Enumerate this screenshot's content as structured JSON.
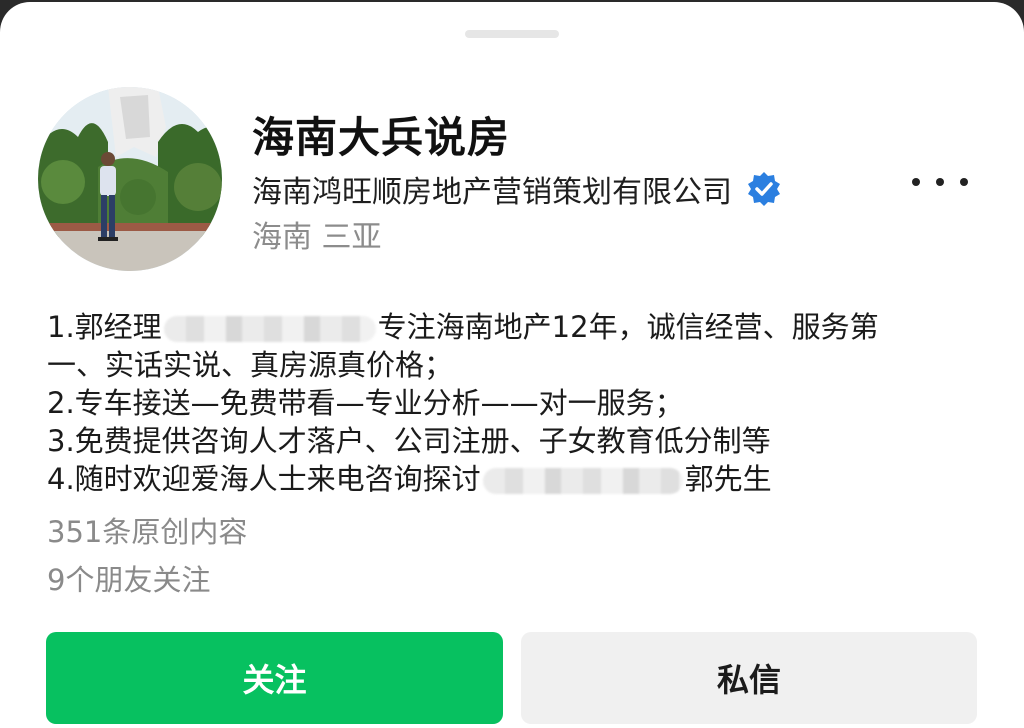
{
  "profile": {
    "name": "海南大兵说房",
    "company": "海南鸿旺顺房地产营销策划有限公司",
    "location": "海南 三亚"
  },
  "bio": {
    "line1_a": "1.郭经理",
    "line1_b": "专注海南地产12年，诚信经营、服务第",
    "line2": "一、实话实说、真房源真价格；",
    "line3": "2.专车接送—免费带看—专业分析——对一服务；",
    "line4": "3.免费提供咨询人才落户、公司注册、子女教育低分制等",
    "line5_a": "4.随时欢迎爱海人士来电咨询探讨",
    "line5_b": "郭先生"
  },
  "stats": {
    "original_content": "351条原创内容",
    "friends_following": "9个朋友关注"
  },
  "actions": {
    "follow_label": "关注",
    "message_label": "私信"
  },
  "colors": {
    "accent_green": "#07c160",
    "verified_blue": "#2b7fe0"
  },
  "icons": {
    "more": "more-options-icon",
    "verified": "verified-badge-icon"
  }
}
